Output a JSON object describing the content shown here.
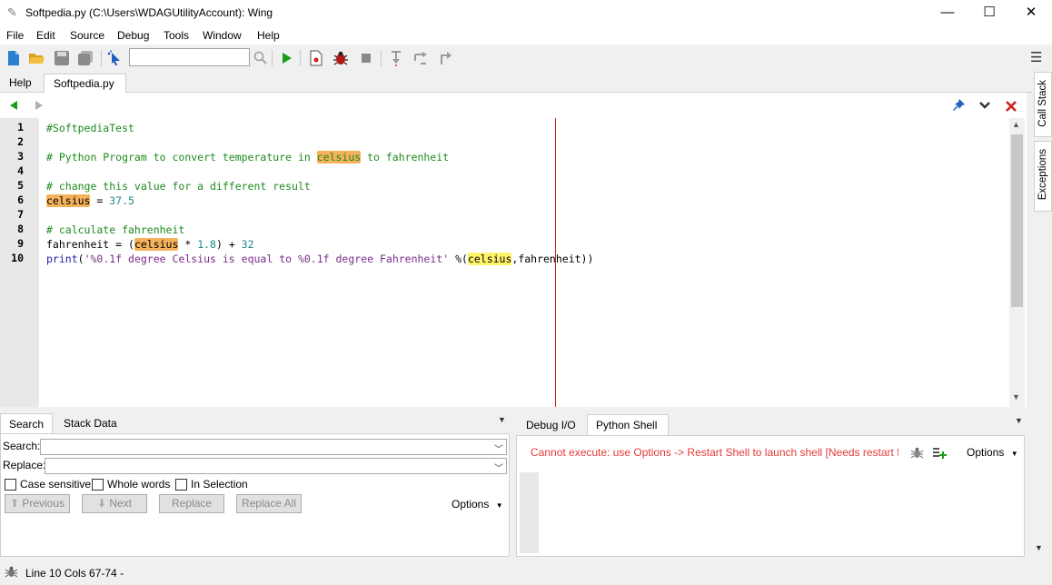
{
  "window": {
    "title": "Softpedia.py (C:\\Users\\WDAGUtilityAccount): Wing",
    "minimize": "—",
    "maximize": "☐",
    "close": "✕"
  },
  "menu": [
    "File",
    "Edit",
    "Source",
    "Debug",
    "Tools",
    "Window",
    "Help"
  ],
  "toolbar": {
    "search_value": "",
    "icons": [
      "new-file-icon",
      "open-folder-icon",
      "save-icon",
      "save-all-icon",
      "select-pointer-icon",
      "search-magnifier-icon",
      "run-icon",
      "debug-file-icon",
      "bug-icon",
      "stop-icon",
      "step-into-icon",
      "step-over-icon",
      "step-out-icon"
    ],
    "menu_icon": "☰"
  },
  "file_tabs": [
    {
      "label": "Help",
      "active": false
    },
    {
      "label": "Softpedia.py",
      "active": true
    }
  ],
  "editor": {
    "line_numbers": [
      "1",
      "2",
      "3",
      "4",
      "5",
      "6",
      "7",
      "8",
      "9",
      "10"
    ],
    "lines": [
      [
        {
          "t": "#SoftpediaTest",
          "c": "cmt"
        }
      ],
      [],
      [
        {
          "t": "# Python Program to convert temperature in ",
          "c": "cmt"
        },
        {
          "t": "celsius",
          "c": "cmt hl"
        },
        {
          "t": " to fahrenheit",
          "c": "cmt"
        }
      ],
      [],
      [
        {
          "t": "# change this value for a different result",
          "c": "cmt"
        }
      ],
      [
        {
          "t": "celsius",
          "c": "hl"
        },
        {
          "t": " = ",
          "c": ""
        },
        {
          "t": "37.5",
          "c": "num"
        }
      ],
      [],
      [
        {
          "t": "# calculate fahrenheit",
          "c": "cmt"
        }
      ],
      [
        {
          "t": "fahrenheit = (",
          "c": ""
        },
        {
          "t": "celsius",
          "c": "hl"
        },
        {
          "t": " * ",
          "c": ""
        },
        {
          "t": "1.8",
          "c": "num"
        },
        {
          "t": ") + ",
          "c": ""
        },
        {
          "t": "32",
          "c": "num"
        }
      ],
      [
        {
          "t": "print",
          "c": "kw"
        },
        {
          "t": "(",
          "c": ""
        },
        {
          "t": "'%0.1f degree Celsius is equal to %0.1f degree Fahrenheit'",
          "c": "str"
        },
        {
          "t": " %(",
          "c": ""
        },
        {
          "t": "celsius",
          "c": "hly"
        },
        {
          "t": ",fahrenheit))",
          "c": ""
        }
      ]
    ]
  },
  "side_tabs": [
    "Call Stack",
    "Exceptions"
  ],
  "search_panel": {
    "tabs": [
      {
        "label": "Search",
        "active": true
      },
      {
        "label": "Stack Data",
        "active": false
      }
    ],
    "search_label": "Search:",
    "replace_label": "Replace:",
    "search_value": "",
    "replace_value": "",
    "checkboxes": [
      "Case sensitive",
      "Whole words",
      "In Selection"
    ],
    "buttons": [
      "Previous",
      "Next",
      "Replace",
      "Replace All"
    ],
    "options": "Options"
  },
  "shell_panel": {
    "tabs": [
      {
        "label": "Debug I/O",
        "active": false
      },
      {
        "label": "Python Shell",
        "active": true
      }
    ],
    "message": "Cannot execute: use Options -> Restart Shell to launch shell [Needs restart for new ...",
    "options": "Options"
  },
  "status": {
    "text": "Line 10 Cols 67-74 -"
  },
  "colors": {
    "comment": "#1d8a1d",
    "highlight": "#f5b25a",
    "highlight_current": "#fff36a",
    "edge_line": "#d02020",
    "error_text": "#e23a3a",
    "run_green": "#1a9e1a"
  }
}
